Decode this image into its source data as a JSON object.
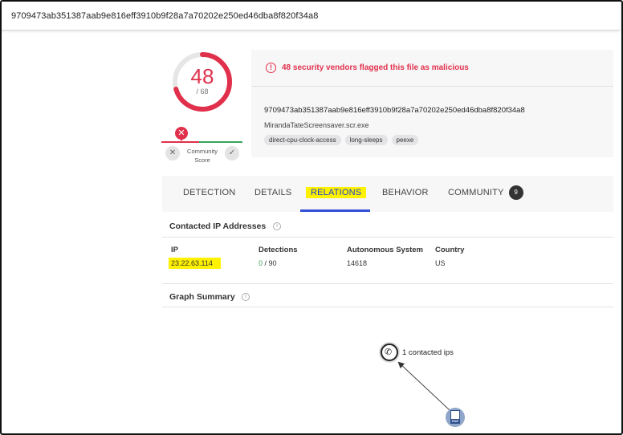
{
  "top": {
    "search_value": "9709473ab351387aab9e816eff3910b9f28a7a70202e250ed46dba8f820f34a8"
  },
  "score": {
    "detections": "48",
    "total": "/ 68"
  },
  "community": {
    "label": "Community Score",
    "down_icon": "close-icon",
    "up_icon": "check-icon"
  },
  "alert": {
    "icon": "alert-circle-icon",
    "text": "48 security vendors flagged this file as malicious"
  },
  "file": {
    "hash": "9709473ab351387aab9e816eff3910b9f28a7a70202e250ed46dba8f820f34a8",
    "name": "MirandaTateScreensaver.scr.exe",
    "tags": [
      "direct-cpu-clock-access",
      "long-sleeps",
      "peexe"
    ]
  },
  "tabs": [
    {
      "label": "DETECTION"
    },
    {
      "label": "DETAILS"
    },
    {
      "label": "RELATIONS",
      "active": true
    },
    {
      "label": "BEHAVIOR"
    },
    {
      "label": "COMMUNITY",
      "badge": "9"
    }
  ],
  "contacted_ips": {
    "title": "Contacted IP Addresses",
    "columns": [
      "IP",
      "Detections",
      "Autonomous System",
      "Country"
    ],
    "rows": [
      {
        "ip": "23.22.63.114",
        "detections_good": "0",
        "detections_total": "/ 90",
        "asn": "14618",
        "country": "US"
      }
    ]
  },
  "graph_summary": {
    "title": "Graph Summary",
    "node_label": "1 contacted ips",
    "file_node_ext": "EXE"
  },
  "colors": {
    "malicious": "#e0304b",
    "harmless": "#39a55b",
    "active_tab": "#3250d6",
    "highlight": "#fff200"
  }
}
